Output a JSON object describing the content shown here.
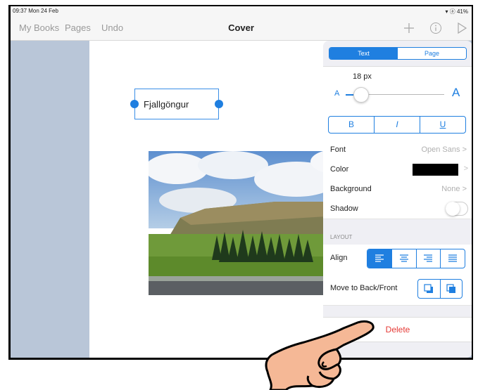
{
  "status": {
    "time": "09:37  Mon 24 Feb",
    "right": "▾ ⓐ 41%"
  },
  "nav": {
    "my_books": "My Books",
    "pages": "Pages",
    "undo": "Undo",
    "title": "Cover"
  },
  "canvas": {
    "text_box": "Fjallgöngur"
  },
  "panel": {
    "tabs": {
      "text": "Text",
      "page": "Page"
    },
    "font_size": "18 px",
    "size_small": "A",
    "size_large": "A",
    "font_size_slider_level": 0.12,
    "style": {
      "bold": "B",
      "italic": "I",
      "underline": "U"
    },
    "font": {
      "label": "Font",
      "value": "Open Sans"
    },
    "color": {
      "label": "Color",
      "value_hex": "#000000"
    },
    "background": {
      "label": "Background",
      "value": "None"
    },
    "shadow": {
      "label": "Shadow",
      "on": false
    },
    "layout_section": "LAYOUT",
    "align": {
      "label": "Align",
      "selected": "left"
    },
    "move": {
      "label": "Move to Back/Front"
    },
    "delete": "Delete",
    "chevron": ">"
  },
  "colors": {
    "accent": "#1f7fe0",
    "delete": "#e53935"
  }
}
